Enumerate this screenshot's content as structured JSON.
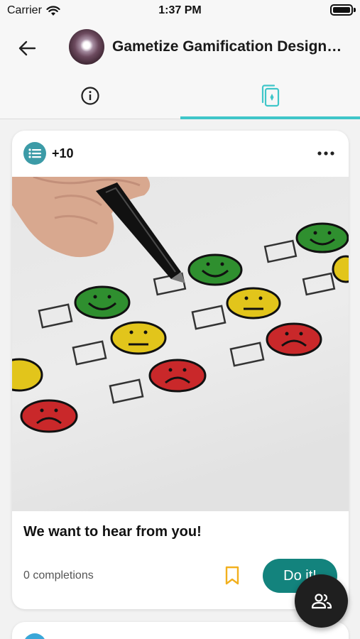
{
  "status_bar": {
    "carrier": "Carrier",
    "time": "1:37 PM",
    "battery_level": 1.0
  },
  "header": {
    "title": "Gametize Gamification Designe...",
    "back_icon": "arrow-left-icon",
    "avatar": "project-avatar"
  },
  "tabs": [
    {
      "name": "about",
      "icon": "info-icon",
      "active": false
    },
    {
      "name": "cards",
      "icon": "cards-icon",
      "active": true
    }
  ],
  "colors": {
    "accent": "#3fc6c9",
    "primary_button": "#13837d",
    "points_badge": "#3c9ba7",
    "bookmark": "#f2b01e",
    "fab": "#1f1f1f"
  },
  "card": {
    "points": "+10",
    "type_icon": "list-icon",
    "more_icon": "more-horizontal-icon",
    "image_subject": "hand with pen ticking boxes next to smiley faces",
    "title": "We want to hear from you!",
    "completions": "0 completions",
    "bookmark_icon": "bookmark-icon",
    "cta_label": "Do it!"
  },
  "fab": {
    "icon": "people-icon"
  }
}
